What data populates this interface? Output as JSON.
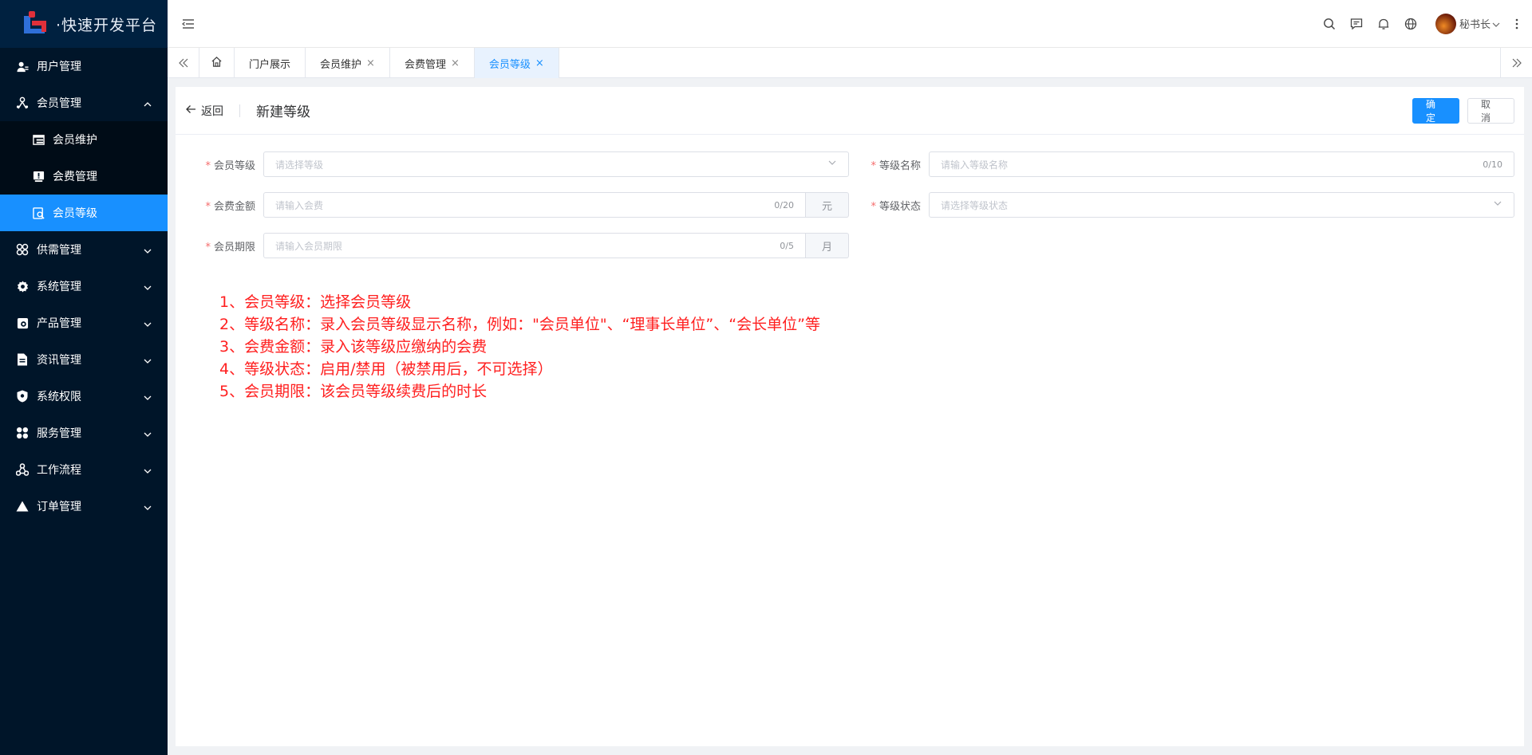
{
  "app": {
    "logo_text": "·快速开发平台"
  },
  "sidebar": {
    "items": [
      {
        "label": "用户管理",
        "icon": "user-icon"
      },
      {
        "label": "会员管理",
        "icon": "member-icon",
        "expanded": true,
        "children": [
          {
            "label": "会员维护",
            "icon": "table-icon"
          },
          {
            "label": "会费管理",
            "icon": "fee-icon"
          },
          {
            "label": "会员等级",
            "icon": "level-icon",
            "active": true
          }
        ]
      },
      {
        "label": "供需管理",
        "icon": "supply-icon"
      },
      {
        "label": "系统管理",
        "icon": "settings-icon"
      },
      {
        "label": "产品管理",
        "icon": "product-icon"
      },
      {
        "label": "资讯管理",
        "icon": "news-icon"
      },
      {
        "label": "系统权限",
        "icon": "shield-icon"
      },
      {
        "label": "服务管理",
        "icon": "service-icon"
      },
      {
        "label": "工作流程",
        "icon": "workflow-icon"
      },
      {
        "label": "订单管理",
        "icon": "order-icon"
      }
    ]
  },
  "header": {
    "user_name": "秘书长"
  },
  "tabs": [
    {
      "label": "门户展示",
      "closable": false
    },
    {
      "label": "会员维护",
      "closable": true
    },
    {
      "label": "会费管理",
      "closable": true
    },
    {
      "label": "会员等级",
      "closable": true,
      "active": true
    }
  ],
  "tab_close_glyph": "×",
  "page": {
    "back_label": "返回",
    "title": "新建等级",
    "confirm_label": "确定",
    "cancel_label": "取消"
  },
  "form": {
    "member_level": {
      "label": "会员等级",
      "placeholder": "请选择等级"
    },
    "level_name": {
      "label": "等级名称",
      "placeholder": "请输入等级名称",
      "count": "0/10"
    },
    "fee_amount": {
      "label": "会费金额",
      "placeholder": "请输入会费",
      "count": "0/20",
      "unit": "元"
    },
    "level_status": {
      "label": "等级状态",
      "placeholder": "请选择等级状态"
    },
    "member_period": {
      "label": "会员期限",
      "placeholder": "请输入会员期限",
      "count": "0/5",
      "unit": "月"
    },
    "required_mark": "*"
  },
  "notes": [
    "1、会员等级：选择会员等级",
    "2、等级名称：录入会员等级显示名称，例如：\"会员单位\"、“理事长单位”、“会长单位”等",
    "3、会费金额：录入该等级应缴纳的会费",
    "4、等级状态：启用/禁用（被禁用后，不可选择）",
    "5、会员期限：该会员等级续费后的时长"
  ],
  "colors": {
    "sidebar_bg": "#001529",
    "active": "#1890ff",
    "note_red": "#ff1f1f"
  }
}
